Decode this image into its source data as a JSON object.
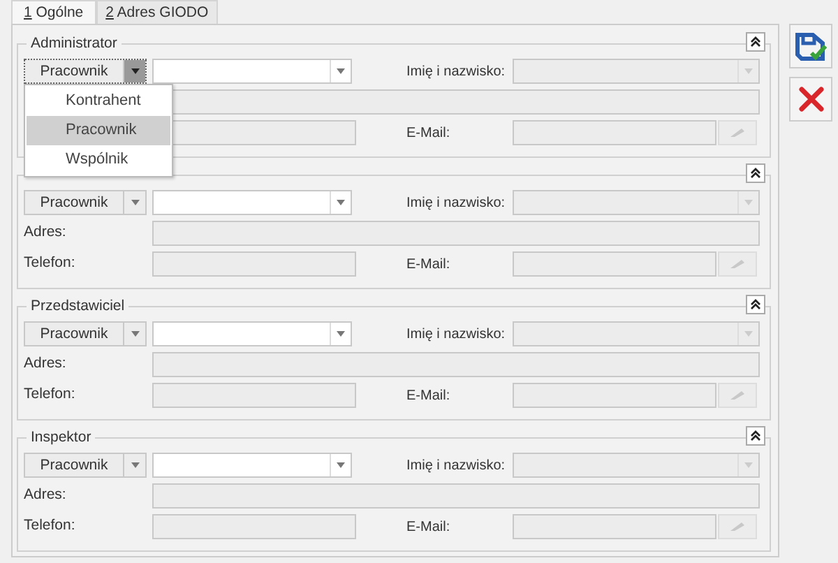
{
  "tabs": [
    {
      "key": "1",
      "label": "Ogólne",
      "selected": true
    },
    {
      "key": "2",
      "label": "Adres GIODO",
      "selected": false
    }
  ],
  "groups": [
    {
      "title": "Administrator",
      "type": "Pracownik",
      "name_label": "Imię i nazwisko:",
      "email_label": "E-Mail:",
      "dropdown": {
        "items": [
          {
            "label": "Kontrahent",
            "selected": false
          },
          {
            "label": "Pracownik",
            "selected": true
          },
          {
            "label": "Wspólnik",
            "selected": false
          }
        ]
      }
    },
    {
      "type": "Pracownik",
      "name_label": "Imię i nazwisko:",
      "address_label": "Adres:",
      "phone_label": "Telefon:",
      "email_label": "E-Mail:"
    },
    {
      "title": "Przedstawiciel",
      "type": "Pracownik",
      "name_label": "Imię i nazwisko:",
      "address_label": "Adres:",
      "phone_label": "Telefon:",
      "email_label": "E-Mail:"
    },
    {
      "title": "Inspektor",
      "type": "Pracownik",
      "name_label": "Imię i nazwisko:",
      "address_label": "Adres:",
      "phone_label": "Telefon:",
      "email_label": "E-Mail:"
    }
  ]
}
